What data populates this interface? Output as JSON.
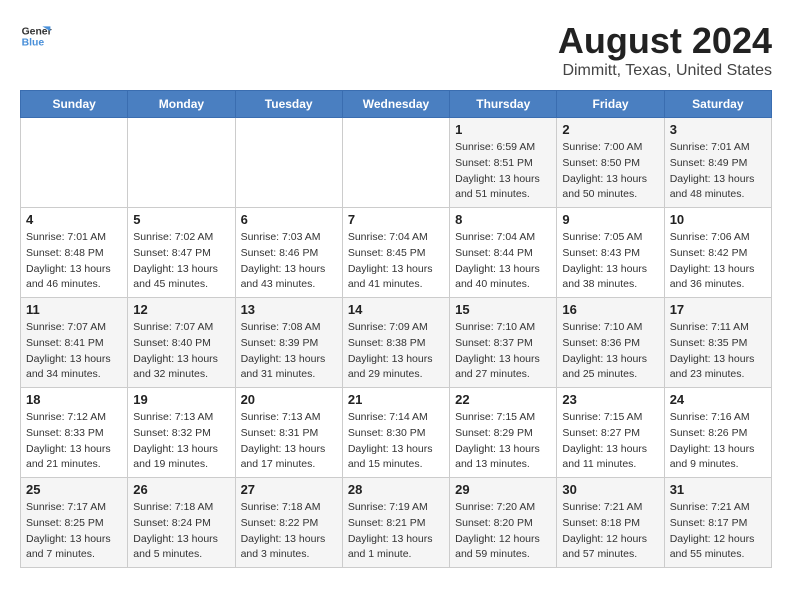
{
  "header": {
    "logo_line1": "General",
    "logo_line2": "Blue",
    "title": "August 2024",
    "subtitle": "Dimmitt, Texas, United States"
  },
  "days_of_week": [
    "Sunday",
    "Monday",
    "Tuesday",
    "Wednesday",
    "Thursday",
    "Friday",
    "Saturday"
  ],
  "weeks": [
    [
      {
        "day": "",
        "info": ""
      },
      {
        "day": "",
        "info": ""
      },
      {
        "day": "",
        "info": ""
      },
      {
        "day": "",
        "info": ""
      },
      {
        "day": "1",
        "info": "Sunrise: 6:59 AM\nSunset: 8:51 PM\nDaylight: 13 hours\nand 51 minutes."
      },
      {
        "day": "2",
        "info": "Sunrise: 7:00 AM\nSunset: 8:50 PM\nDaylight: 13 hours\nand 50 minutes."
      },
      {
        "day": "3",
        "info": "Sunrise: 7:01 AM\nSunset: 8:49 PM\nDaylight: 13 hours\nand 48 minutes."
      }
    ],
    [
      {
        "day": "4",
        "info": "Sunrise: 7:01 AM\nSunset: 8:48 PM\nDaylight: 13 hours\nand 46 minutes."
      },
      {
        "day": "5",
        "info": "Sunrise: 7:02 AM\nSunset: 8:47 PM\nDaylight: 13 hours\nand 45 minutes."
      },
      {
        "day": "6",
        "info": "Sunrise: 7:03 AM\nSunset: 8:46 PM\nDaylight: 13 hours\nand 43 minutes."
      },
      {
        "day": "7",
        "info": "Sunrise: 7:04 AM\nSunset: 8:45 PM\nDaylight: 13 hours\nand 41 minutes."
      },
      {
        "day": "8",
        "info": "Sunrise: 7:04 AM\nSunset: 8:44 PM\nDaylight: 13 hours\nand 40 minutes."
      },
      {
        "day": "9",
        "info": "Sunrise: 7:05 AM\nSunset: 8:43 PM\nDaylight: 13 hours\nand 38 minutes."
      },
      {
        "day": "10",
        "info": "Sunrise: 7:06 AM\nSunset: 8:42 PM\nDaylight: 13 hours\nand 36 minutes."
      }
    ],
    [
      {
        "day": "11",
        "info": "Sunrise: 7:07 AM\nSunset: 8:41 PM\nDaylight: 13 hours\nand 34 minutes."
      },
      {
        "day": "12",
        "info": "Sunrise: 7:07 AM\nSunset: 8:40 PM\nDaylight: 13 hours\nand 32 minutes."
      },
      {
        "day": "13",
        "info": "Sunrise: 7:08 AM\nSunset: 8:39 PM\nDaylight: 13 hours\nand 31 minutes."
      },
      {
        "day": "14",
        "info": "Sunrise: 7:09 AM\nSunset: 8:38 PM\nDaylight: 13 hours\nand 29 minutes."
      },
      {
        "day": "15",
        "info": "Sunrise: 7:10 AM\nSunset: 8:37 PM\nDaylight: 13 hours\nand 27 minutes."
      },
      {
        "day": "16",
        "info": "Sunrise: 7:10 AM\nSunset: 8:36 PM\nDaylight: 13 hours\nand 25 minutes."
      },
      {
        "day": "17",
        "info": "Sunrise: 7:11 AM\nSunset: 8:35 PM\nDaylight: 13 hours\nand 23 minutes."
      }
    ],
    [
      {
        "day": "18",
        "info": "Sunrise: 7:12 AM\nSunset: 8:33 PM\nDaylight: 13 hours\nand 21 minutes."
      },
      {
        "day": "19",
        "info": "Sunrise: 7:13 AM\nSunset: 8:32 PM\nDaylight: 13 hours\nand 19 minutes."
      },
      {
        "day": "20",
        "info": "Sunrise: 7:13 AM\nSunset: 8:31 PM\nDaylight: 13 hours\nand 17 minutes."
      },
      {
        "day": "21",
        "info": "Sunrise: 7:14 AM\nSunset: 8:30 PM\nDaylight: 13 hours\nand 15 minutes."
      },
      {
        "day": "22",
        "info": "Sunrise: 7:15 AM\nSunset: 8:29 PM\nDaylight: 13 hours\nand 13 minutes."
      },
      {
        "day": "23",
        "info": "Sunrise: 7:15 AM\nSunset: 8:27 PM\nDaylight: 13 hours\nand 11 minutes."
      },
      {
        "day": "24",
        "info": "Sunrise: 7:16 AM\nSunset: 8:26 PM\nDaylight: 13 hours\nand 9 minutes."
      }
    ],
    [
      {
        "day": "25",
        "info": "Sunrise: 7:17 AM\nSunset: 8:25 PM\nDaylight: 13 hours\nand 7 minutes."
      },
      {
        "day": "26",
        "info": "Sunrise: 7:18 AM\nSunset: 8:24 PM\nDaylight: 13 hours\nand 5 minutes."
      },
      {
        "day": "27",
        "info": "Sunrise: 7:18 AM\nSunset: 8:22 PM\nDaylight: 13 hours\nand 3 minutes."
      },
      {
        "day": "28",
        "info": "Sunrise: 7:19 AM\nSunset: 8:21 PM\nDaylight: 13 hours\nand 1 minute."
      },
      {
        "day": "29",
        "info": "Sunrise: 7:20 AM\nSunset: 8:20 PM\nDaylight: 12 hours\nand 59 minutes."
      },
      {
        "day": "30",
        "info": "Sunrise: 7:21 AM\nSunset: 8:18 PM\nDaylight: 12 hours\nand 57 minutes."
      },
      {
        "day": "31",
        "info": "Sunrise: 7:21 AM\nSunset: 8:17 PM\nDaylight: 12 hours\nand 55 minutes."
      }
    ]
  ]
}
